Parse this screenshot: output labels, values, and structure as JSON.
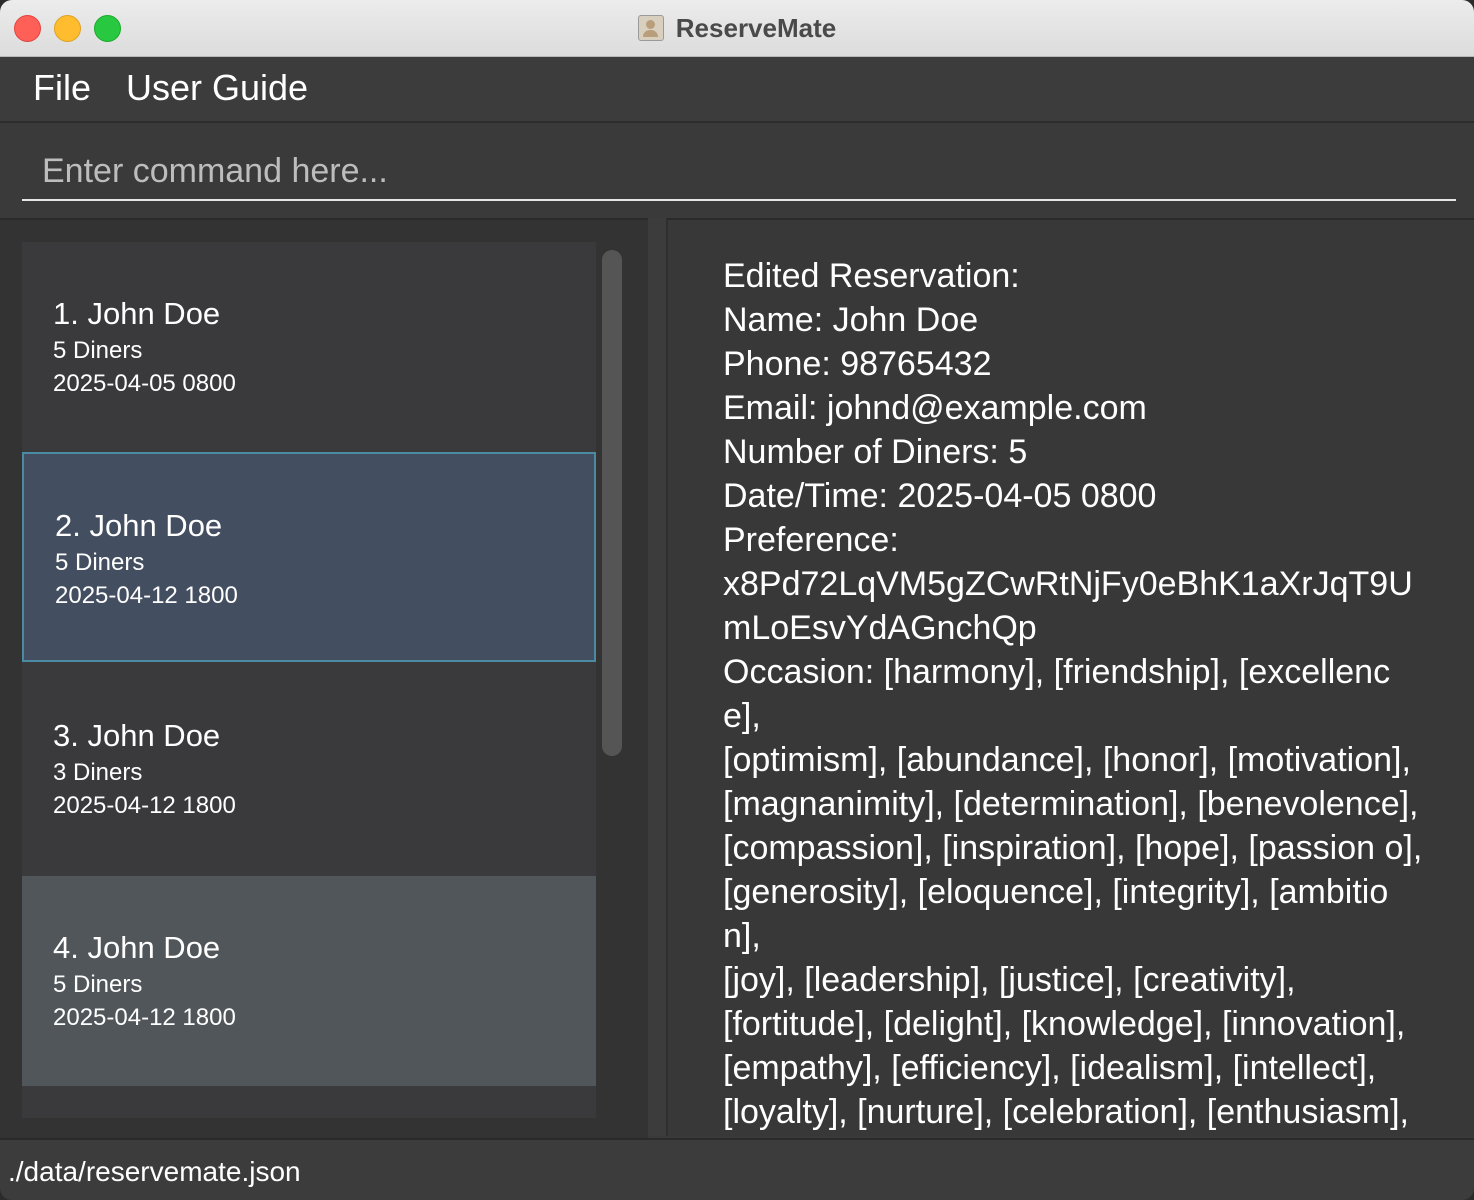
{
  "window": {
    "title": "ReserveMate",
    "app_icon": "contact-card-icon"
  },
  "menu": {
    "file": "File",
    "user_guide": "User Guide"
  },
  "command": {
    "placeholder": "Enter command here...",
    "value": ""
  },
  "reservations": [
    {
      "name": "1. John Doe",
      "diners": "5 Diners",
      "datetime": "2025-04-05 0800"
    },
    {
      "name": "2. John Doe",
      "diners": "5 Diners",
      "datetime": "2025-04-12 1800"
    },
    {
      "name": "3. John Doe",
      "diners": "3 Diners",
      "datetime": "2025-04-12 1800"
    },
    {
      "name": "4. John Doe",
      "diners": "5 Diners",
      "datetime": "2025-04-12 1800"
    }
  ],
  "result": {
    "text": "Edited Reservation:\nName: John Doe\nPhone: 98765432\nEmail: johnd@example.com\nNumber of Diners: 5\nDate/Time: 2025-04-05 0800\nPreference:\nx8Pd72LqVM5gZCwRtNjFy0eBhK1aXrJqT9U\nmLoEsvYdAGnchQp\nOccasion: [harmony], [friendship], [excellence],\n[optimism], [abundance], [honor], [motivation],\n[magnanimity], [determination], [benevolence],\n[compassion], [inspiration], [hope], [passion o],\n[generosity], [eloquence], [integrity], [ambition],\n[joy], [leadership], [justice], [creativity],\n[fortitude], [delight], [knowledge], [innovation],\n[empathy], [efficiency], [idealism], [intellect],\n[loyalty], [nurture], [celebration], [enthusiasm],\n[gratitude], [affection], [aspiration]"
  },
  "status": {
    "path": "./data/reservemate.json"
  }
}
